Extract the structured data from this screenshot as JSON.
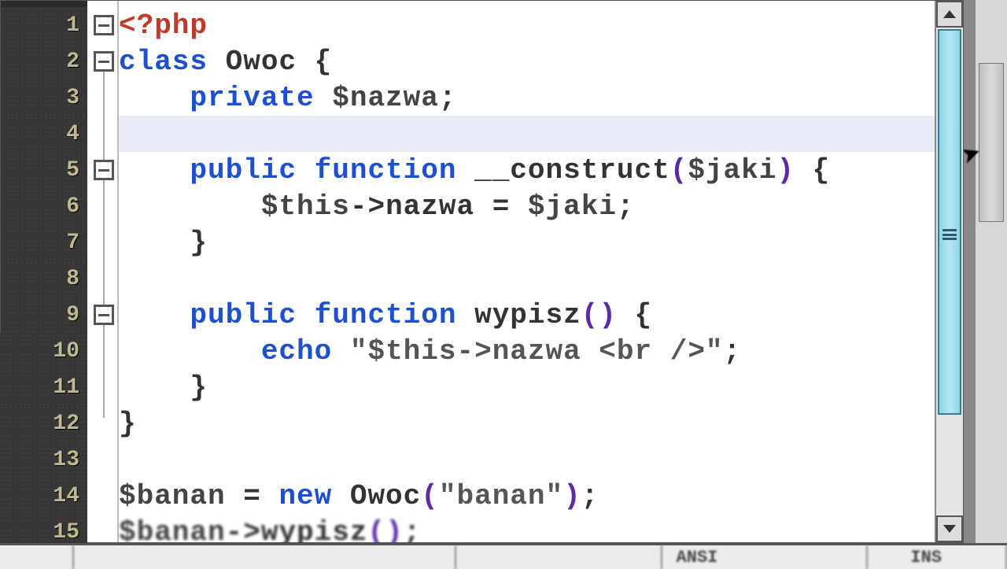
{
  "line_numbers": [
    "1",
    "2",
    "3",
    "4",
    "5",
    "6",
    "7",
    "8",
    "9",
    "10",
    "11",
    "12",
    "13",
    "14",
    "15"
  ],
  "code": {
    "l1": {
      "a": "<?php"
    },
    "l2": {
      "a": "class",
      "b": " Owoc ",
      "c": "{"
    },
    "l3": {
      "a": "    private",
      "b": " $nazwa",
      "c": ";"
    },
    "l4": {
      "a": ""
    },
    "l5": {
      "a": "    public",
      "b": " function",
      "c": " __construct",
      "d": "(",
      "e": "$jaki",
      "f": ")",
      "g": " {"
    },
    "l6": {
      "a": "        $this",
      "b": "->",
      "c": "nazwa",
      "d": " = ",
      "e": "$jaki",
      "f": ";"
    },
    "l7": {
      "a": "    }"
    },
    "l8": {
      "a": ""
    },
    "l9": {
      "a": "    public",
      "b": " function",
      "c": " wypisz",
      "d": "()",
      "e": " {"
    },
    "l10": {
      "a": "        echo ",
      "b": "\"$this->nazwa <br />\"",
      "c": ";"
    },
    "l11": {
      "a": "    }"
    },
    "l12": {
      "a": "}"
    },
    "l13": {
      "a": ""
    },
    "l14": {
      "a": "$banan",
      "b": " = ",
      "c": "new",
      "d": " Owoc",
      "e": "(",
      "f": "\"banan\"",
      "g": ")",
      "h": ";"
    },
    "l15": {
      "a": "$banan",
      "b": "->",
      "c": "wypisz",
      "d": "()",
      "e": ";"
    }
  },
  "status": {
    "a": "",
    "enc": "ANSI",
    "b": "INS"
  }
}
